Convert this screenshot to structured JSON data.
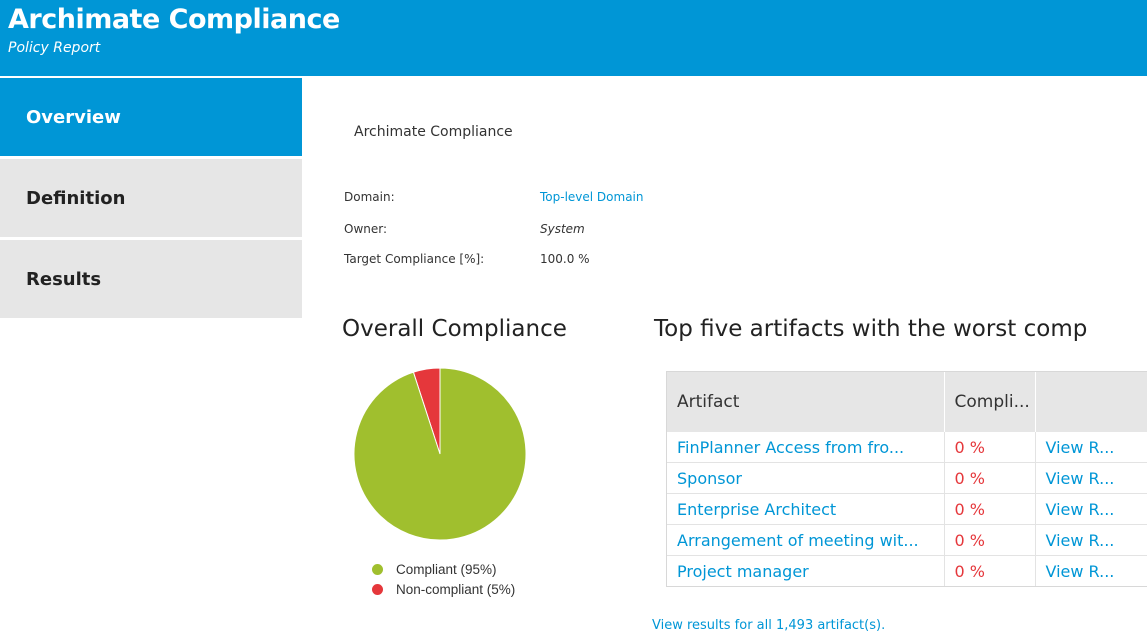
{
  "header": {
    "title": "Archimate Compliance",
    "subtitle": "Policy Report"
  },
  "sidebar": {
    "items": [
      {
        "label": "Overview",
        "active": true
      },
      {
        "label": "Definition",
        "active": false
      },
      {
        "label": "Results",
        "active": false
      }
    ]
  },
  "overview": {
    "policy_name": "Archimate Compliance",
    "properties": [
      {
        "label": "Domain:",
        "value": "Top-level Domain"
      },
      {
        "label": "Owner:",
        "value": "System"
      },
      {
        "label": "Target Compliance [%]:",
        "value": "100.0 %"
      }
    ]
  },
  "overall": {
    "title": "Overall Compliance",
    "legend": [
      {
        "label": "Compliant (95%)",
        "color": "#a0bf2e"
      },
      {
        "label": "Non-compliant (5%)",
        "color": "#e5373b"
      }
    ]
  },
  "chart_data": {
    "type": "pie",
    "categories": [
      "Compliant",
      "Non-compliant"
    ],
    "values": [
      95,
      5
    ],
    "colors": [
      "#a0bf2e",
      "#e5373b"
    ]
  },
  "worst": {
    "title": "Top five artifacts with the worst comp",
    "columns": [
      "Artifact",
      "Compli...",
      ""
    ],
    "rows": [
      {
        "artifact": "FinPlanner Access from fro...",
        "compliance": "0 %",
        "action": "View R..."
      },
      {
        "artifact": "Sponsor",
        "compliance": "0 %",
        "action": "View R..."
      },
      {
        "artifact": "Enterprise Architect",
        "compliance": "0 %",
        "action": "View R..."
      },
      {
        "artifact": "Arrangement of meeting wit...",
        "compliance": "0 %",
        "action": "View R..."
      },
      {
        "artifact": "Project manager",
        "compliance": "0 %",
        "action": "View R..."
      }
    ],
    "view_all": "View results for all 1,493 artifact(s)."
  },
  "colors": {
    "accent": "#0096d6",
    "nav_inactive": "#e6e6e6",
    "compliant": "#a0bf2e",
    "noncompliant": "#e5373b"
  }
}
